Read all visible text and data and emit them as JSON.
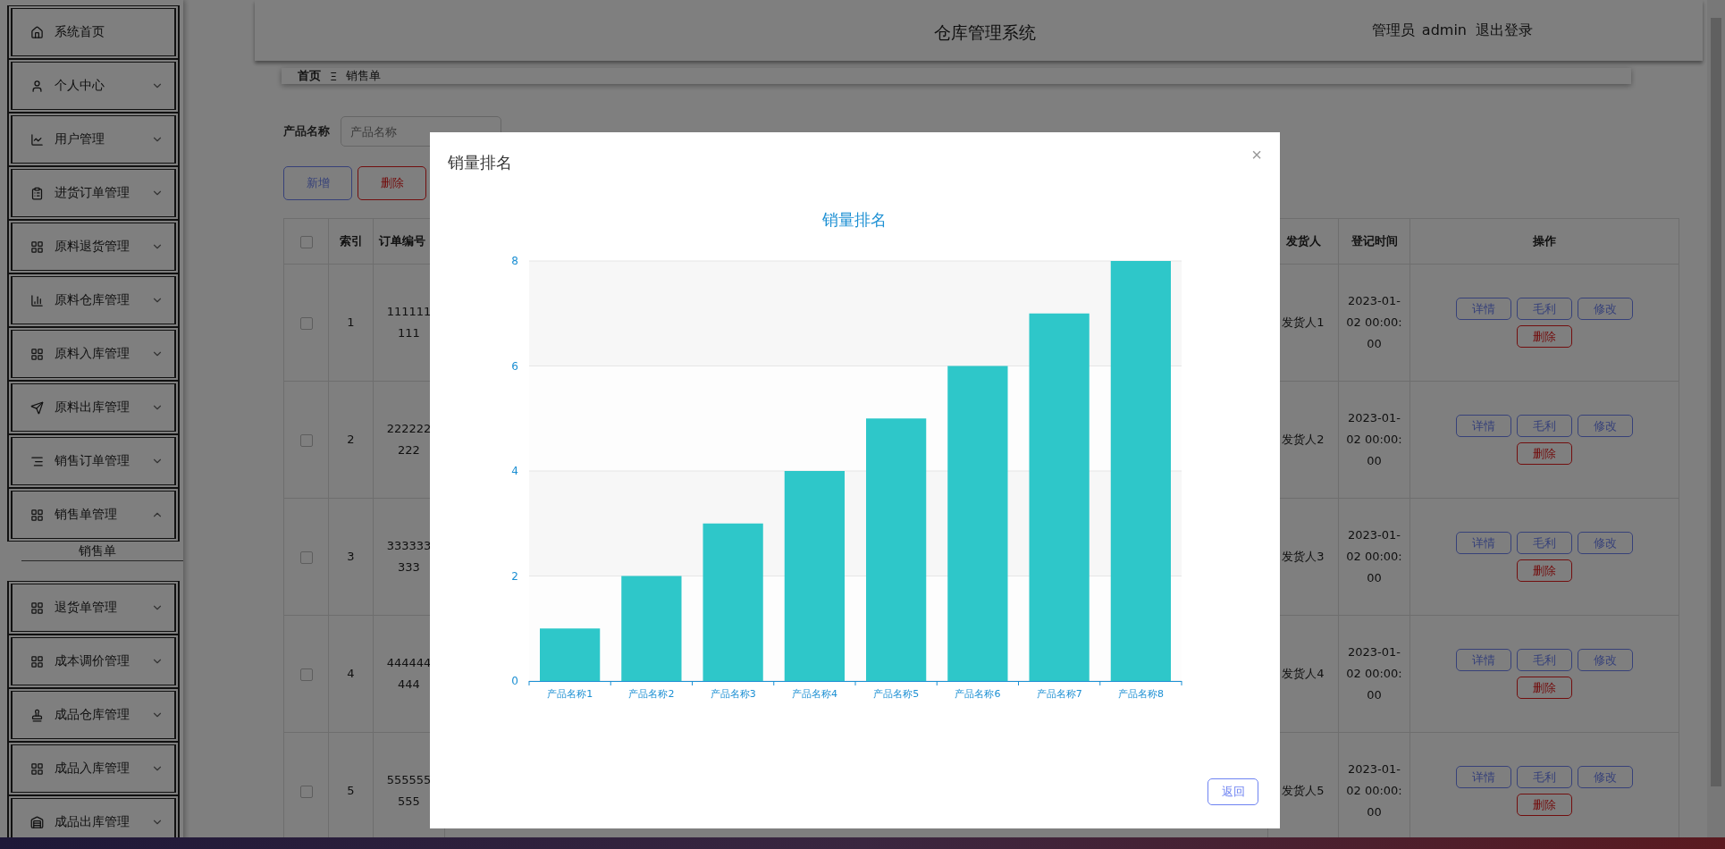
{
  "sidebar": {
    "items": [
      {
        "label": "系统首页"
      },
      {
        "label": "个人中心",
        "expanded": false
      },
      {
        "label": "用户管理",
        "expanded": false
      },
      {
        "label": "进货订单管理",
        "expanded": false
      },
      {
        "label": "原料退货管理",
        "expanded": false
      },
      {
        "label": "原料仓库管理",
        "expanded": false
      },
      {
        "label": "原料入库管理",
        "expanded": false
      },
      {
        "label": "原料出库管理",
        "expanded": false
      },
      {
        "label": "销售订单管理",
        "expanded": false
      },
      {
        "label": "销售单管理",
        "expanded": true,
        "children": [
          {
            "label": "销售单"
          }
        ]
      },
      {
        "label": "退货单管理",
        "expanded": false
      },
      {
        "label": "成本调价管理",
        "expanded": false
      },
      {
        "label": "成品仓库管理",
        "expanded": false
      },
      {
        "label": "成品入库管理",
        "expanded": false
      },
      {
        "label": "成品出库管理",
        "expanded": false
      }
    ]
  },
  "header": {
    "title": "仓库管理系统",
    "role": "管理员",
    "user": "admin",
    "logout": "退出登录"
  },
  "breadcrumb": {
    "home": "首页",
    "separator": "Ξ",
    "current": "销售单"
  },
  "search": {
    "label": "产品名称",
    "placeholder": "产品名称"
  },
  "toolbar": [
    {
      "label": "新增",
      "kind": "primary"
    },
    {
      "label": "删除",
      "kind": "danger"
    }
  ],
  "table": {
    "header_checked": false,
    "columns": {
      "index": "索引",
      "order_no": "订单编号",
      "shipper": "发货人",
      "time": "登记时间",
      "actions": "操作"
    },
    "rows": [
      {
        "checked": false,
        "index": "1",
        "order_no": "111111 111",
        "shipper": "发货人1",
        "time": "2023-01-02 00:00:00",
        "actions": [
          {
            "label": "详情",
            "kind": "primary"
          },
          {
            "label": "毛利",
            "kind": "primary"
          },
          {
            "label": "修改",
            "kind": "primary"
          },
          {
            "label": "删除",
            "kind": "danger"
          }
        ]
      },
      {
        "checked": false,
        "index": "2",
        "order_no": "222222 222",
        "shipper": "发货人2",
        "time": "2023-01-02 00:00:00",
        "actions": [
          {
            "label": "详情",
            "kind": "primary"
          },
          {
            "label": "毛利",
            "kind": "primary"
          },
          {
            "label": "修改",
            "kind": "primary"
          },
          {
            "label": "删除",
            "kind": "danger"
          }
        ]
      },
      {
        "checked": false,
        "index": "3",
        "order_no": "333333 333",
        "shipper": "发货人3",
        "time": "2023-01-02 00:00:00",
        "actions": [
          {
            "label": "详情",
            "kind": "primary"
          },
          {
            "label": "毛利",
            "kind": "primary"
          },
          {
            "label": "修改",
            "kind": "primary"
          },
          {
            "label": "删除",
            "kind": "danger"
          }
        ]
      },
      {
        "checked": false,
        "index": "4",
        "order_no": "444444 444",
        "shipper": "发货人4",
        "time": "2023-01-02 00:00:00",
        "actions": [
          {
            "label": "详情",
            "kind": "primary"
          },
          {
            "label": "毛利",
            "kind": "primary"
          },
          {
            "label": "修改",
            "kind": "primary"
          },
          {
            "label": "删除",
            "kind": "danger"
          }
        ]
      },
      {
        "checked": false,
        "index": "5",
        "order_no": "555555 555",
        "shipper": "发货人5",
        "time": "2023-01-02 00:00:00",
        "actions": [
          {
            "label": "详情",
            "kind": "primary"
          },
          {
            "label": "毛利",
            "kind": "primary"
          },
          {
            "label": "修改",
            "kind": "primary"
          },
          {
            "label": "删除",
            "kind": "danger"
          }
        ]
      }
    ]
  },
  "modal": {
    "title": "销量排名",
    "close": "×",
    "button": "返回",
    "chart_data": {
      "type": "bar",
      "title": "销量排名",
      "categories": [
        "产品名称1",
        "产品名称2",
        "产品名称3",
        "产品名称4",
        "产品名称5",
        "产品名称6",
        "产品名称7",
        "产品名称8"
      ],
      "series": [
        {
          "color": "#2ec7c9",
          "values": [
            1,
            2,
            3,
            4,
            5,
            6,
            7,
            8
          ]
        }
      ],
      "ylim": [
        0,
        8
      ],
      "yticks": [
        0,
        2,
        4,
        6,
        8
      ],
      "grid": true
    }
  }
}
